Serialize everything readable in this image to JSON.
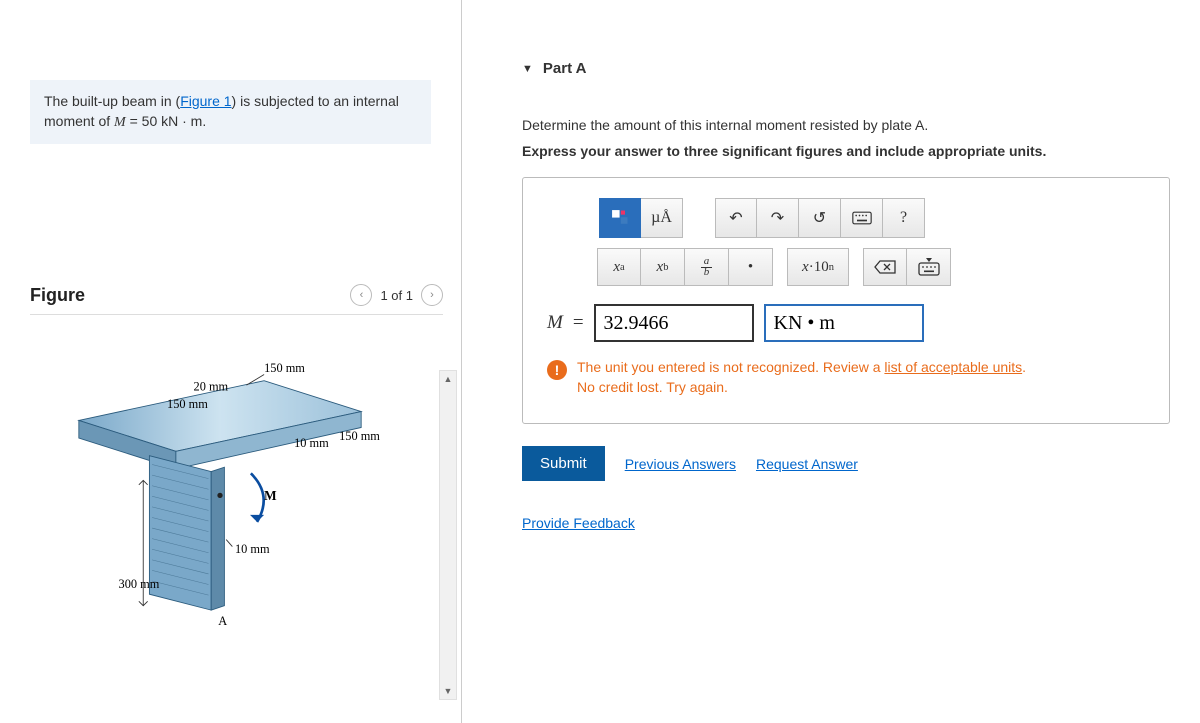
{
  "problem": {
    "prefix": "The built-up beam in (",
    "figure_link": "Figure 1",
    "suffix": ") is subjected to an internal moment of ",
    "moment_var": "M",
    "moment_eq": " = 50 kN · m."
  },
  "figure": {
    "heading": "Figure",
    "pager": "1 of 1",
    "labels": {
      "d150a": "150 mm",
      "d20": "20 mm",
      "d150b": "150 mm",
      "d150c": "150 mm",
      "d10a": "10 mm",
      "d10b": "10 mm",
      "d300": "300 mm",
      "M": "M",
      "A": "A"
    }
  },
  "part": {
    "title": "Part A",
    "question": "Determine the amount of this internal moment resisted by plate A.",
    "instruction": "Express your answer to three significant figures and include appropriate units."
  },
  "toolbar": {
    "units_mu": "µÅ",
    "help": "?",
    "xa": "xᵃ",
    "xb": "x_b",
    "frac": "a/b",
    "dot": "•",
    "sci": "x·10ⁿ"
  },
  "answer": {
    "var": "M",
    "eq": "=",
    "value": "32.9466",
    "unit": "KN • m"
  },
  "feedback": {
    "line1_pre": "The unit you entered is not recognized. Review a ",
    "line1_link": "list of acceptable units",
    "line1_post": ".",
    "line2": "No credit lost. Try again."
  },
  "buttons": {
    "submit": "Submit",
    "prev": "Previous Answers",
    "req": "Request Answer",
    "provide": "Provide Feedback"
  }
}
